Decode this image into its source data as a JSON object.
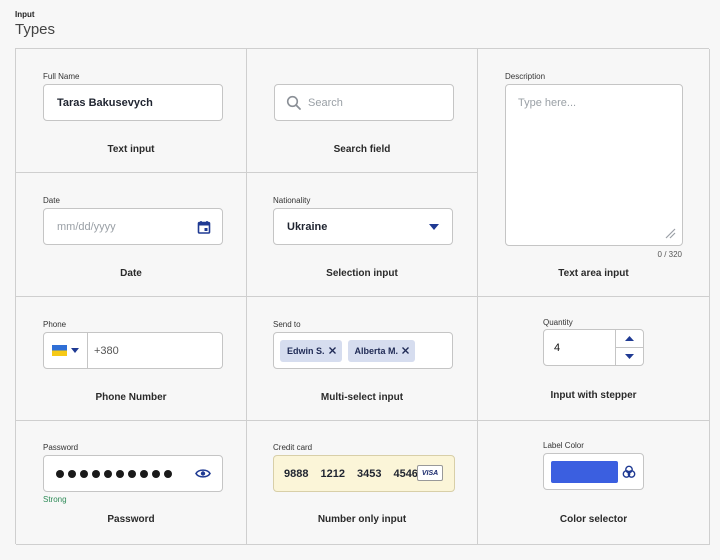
{
  "header": {
    "kicker": "Input",
    "title": "Types"
  },
  "text_input": {
    "label": "Full Name",
    "value": "Taras Bakusevych",
    "caption": "Text input"
  },
  "search_field": {
    "placeholder": "Search",
    "caption": "Search field"
  },
  "textarea": {
    "label": "Description",
    "placeholder": "Type here...",
    "counter": "0 / 320",
    "caption": "Text area input"
  },
  "date": {
    "label": "Date",
    "placeholder": "mm/dd/yyyy",
    "caption": "Date"
  },
  "selection": {
    "label": "Nationality",
    "value": "Ukraine",
    "caption": "Selection input"
  },
  "phone": {
    "label": "Phone",
    "country_code": "+380",
    "caption": "Phone Number"
  },
  "multiselect": {
    "label": "Send to",
    "chips": [
      "Edwin S.",
      "Alberta M."
    ],
    "caption": "Multi-select input"
  },
  "stepper": {
    "label": "Quantity",
    "value": "4",
    "caption": "Input with stepper"
  },
  "password": {
    "label": "Password",
    "strength": "Strong",
    "caption": "Password",
    "strength_color": "#2e8b57"
  },
  "credit_card": {
    "label": "Credit card",
    "groups": [
      "9888",
      "1212",
      "3453",
      "4546"
    ],
    "brand": "VISA",
    "caption": "Number only input",
    "background": "#fbf5d8"
  },
  "color_selector": {
    "label": "Label Color",
    "swatch": "#3b5fe0",
    "caption": "Color selector"
  },
  "accent": "#1f3a93"
}
